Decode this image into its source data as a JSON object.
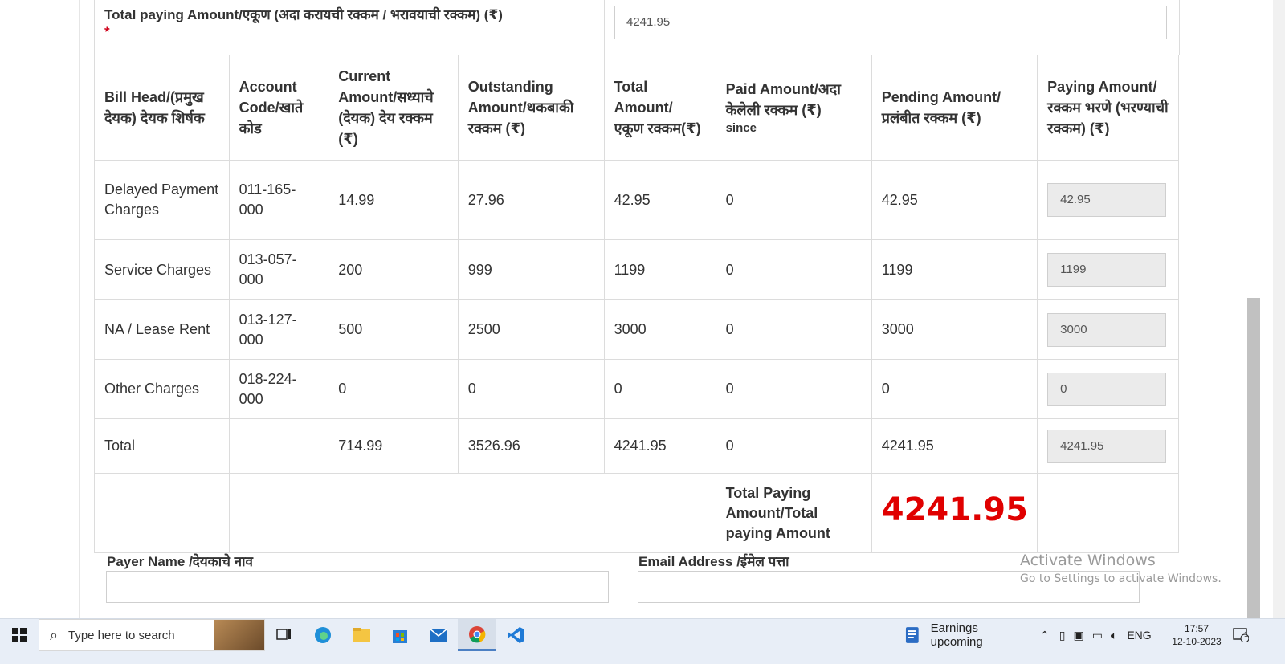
{
  "form": {
    "total_paying_label": "Total paying Amount/एकूण (अदा करायची रक्कम / भरावयाची रक्कम) (₹)",
    "required_mark": "*",
    "total_paying_value": "4241.95"
  },
  "table": {
    "headers": {
      "bill_head": "Bill Head/(प्रमुख देयक) देयक शिर्षक",
      "account_code": "Account Code/खाते कोड",
      "current_amount": "Current Amount/सध्याचे (देयक) देय रक्कम (₹)",
      "outstanding_amount": "Outstanding Amount/थकबाकी रक्कम (₹)",
      "total_amount": "Total Amount/ एकूण रक्कम(₹)",
      "paid_amount": "Paid Amount/अदा केलेली रक्कम (₹)",
      "paid_since": "since",
      "pending_amount": "Pending Amount/ प्रलंबीत रक्कम (₹)",
      "paying_amount": "Paying Amount/ रक्कम भरणे (भरण्याची रक्कम) (₹)"
    },
    "rows": [
      {
        "bill_head": "Delayed Payment Charges",
        "account_code": "011-165-000",
        "current": "14.99",
        "outstanding": "27.96",
        "total": "42.95",
        "paid": "0",
        "pending": "42.95",
        "paying": "42.95"
      },
      {
        "bill_head": "Service Charges",
        "account_code": "013-057-000",
        "current": "200",
        "outstanding": "999",
        "total": "1199",
        "paid": "0",
        "pending": "1199",
        "paying": "1199"
      },
      {
        "bill_head": "NA / Lease Rent",
        "account_code": "013-127-000",
        "current": "500",
        "outstanding": "2500",
        "total": "3000",
        "paid": "0",
        "pending": "3000",
        "paying": "3000"
      },
      {
        "bill_head": "Other Charges",
        "account_code": "018-224-000",
        "current": "0",
        "outstanding": "0",
        "total": "0",
        "paid": "0",
        "pending": "0",
        "paying": "0"
      }
    ],
    "total_row": {
      "label": "Total",
      "account_code": "",
      "current": "714.99",
      "outstanding": "3526.96",
      "total": "4241.95",
      "paid": "0",
      "pending": "4241.95",
      "paying": "4241.95"
    },
    "grand_total_label": "Total Paying Amount/Total paying Amount",
    "grand_total_value": "4241.95"
  },
  "payer": {
    "name_label": "Payer Name /देयकाचे नाव",
    "name_value": "",
    "email_label": "Email Address /ईमेल पत्ता",
    "email_value": ""
  },
  "watermark": {
    "line1": "Activate Windows",
    "line2": "Go to Settings to activate Windows."
  },
  "taskbar": {
    "search_placeholder": "Type here to search",
    "earnings_label": "Earnings upcoming",
    "language": "ENG",
    "time": "17:57",
    "date": "12-10-2023",
    "notification_count": "1",
    "icons": [
      "windows-start-icon",
      "search-icon",
      "task-view-icon",
      "edge-icon",
      "file-explorer-icon",
      "microsoft-store-icon",
      "mail-icon",
      "chrome-icon",
      "vscode-icon"
    ]
  },
  "colors": {
    "grand_total": "#e00000",
    "required": "#d0021b",
    "readonly_input_bg": "#ebebeb"
  }
}
